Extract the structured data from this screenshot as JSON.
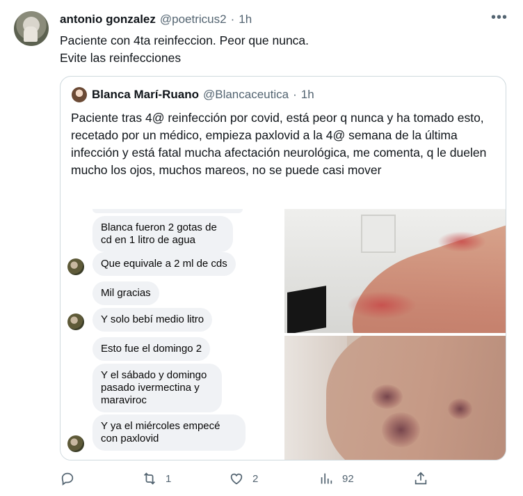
{
  "tweet": {
    "author_name": "antonio gonzalez",
    "author_handle": "@poetricus2",
    "separator": "·",
    "time": "1h",
    "more": "•••",
    "text_line1": "Paciente con 4ta reinfeccion. Peor que nunca.",
    "text_line2": "Evite las reinfecciones"
  },
  "quote": {
    "author_name": "Blanca Marí-Ruano",
    "author_handle": "@Blancaceutica",
    "separator": "·",
    "time": "1h",
    "text": "Paciente tras 4@ reinfección por covid, está peor q nunca y ha tomado esto, recetado por un médico, empieza paxlovid a la 4@ semana de la última infección y está fatal mucha afectación neurológica, me comenta, q le duelen mucho los ojos, muchos mareos, no se puede casi mover",
    "chat": [
      "Blanca fueron 2 gotas de cd en 1 litro de agua",
      "Que equivale a 2 ml de cds",
      "Mil gracias",
      "Y solo bebí medio litro",
      "Esto fue el domingo 2",
      "Y el sábado y domingo pasado ivermectina y maraviroc",
      "Y ya el miércoles empecé con paxlovid"
    ]
  },
  "actions": {
    "reply_icon": "reply-icon",
    "retweet_icon": "retweet-icon",
    "retweets": "1",
    "like_icon": "heart-icon",
    "likes": "2",
    "views_icon": "views-icon",
    "views": "92",
    "share_icon": "share-icon"
  }
}
